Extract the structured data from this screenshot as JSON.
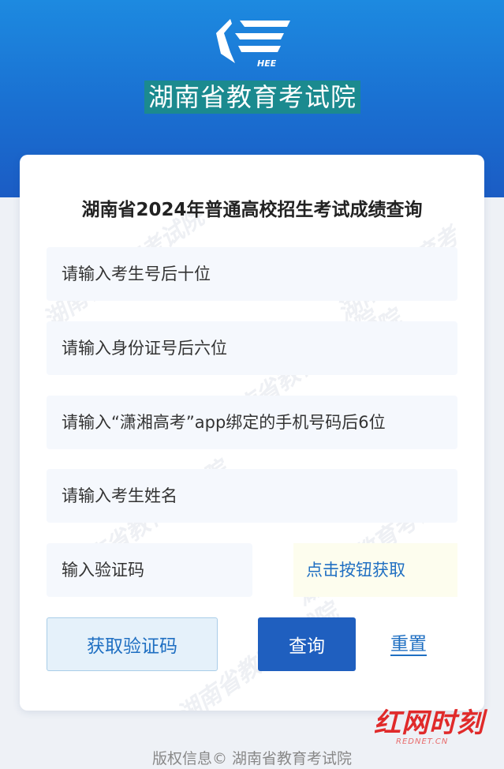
{
  "header": {
    "logo_text": "HEE",
    "org_name": "湖南省教育考试院"
  },
  "card": {
    "title": "湖南省2024年普通高校招生考试成绩查询",
    "watermark": "湖南省教育考试院"
  },
  "form": {
    "exam_number_placeholder": "请输入考生号后十位",
    "id_card_placeholder": "请输入身份证号后六位",
    "phone_placeholder": "请输入“潇湘高考”app绑定的手机号码后6位",
    "name_placeholder": "请输入考生姓名",
    "captcha_placeholder": "输入验证码",
    "captcha_hint": "点击按钮获取"
  },
  "actions": {
    "get_captcha_label": "获取验证码",
    "query_label": "查询",
    "reset_label": "重置"
  },
  "brand": {
    "name": "红网时刻",
    "sub": "REDNET.CN"
  },
  "footer": {
    "copyright": "版权信息© 湖南省教育考试院"
  },
  "colors": {
    "header_blue": "#1a6fd1",
    "title_bg": "#1b8a8f",
    "primary_button": "#1f5fbf",
    "link_blue": "#1f6fc2"
  }
}
